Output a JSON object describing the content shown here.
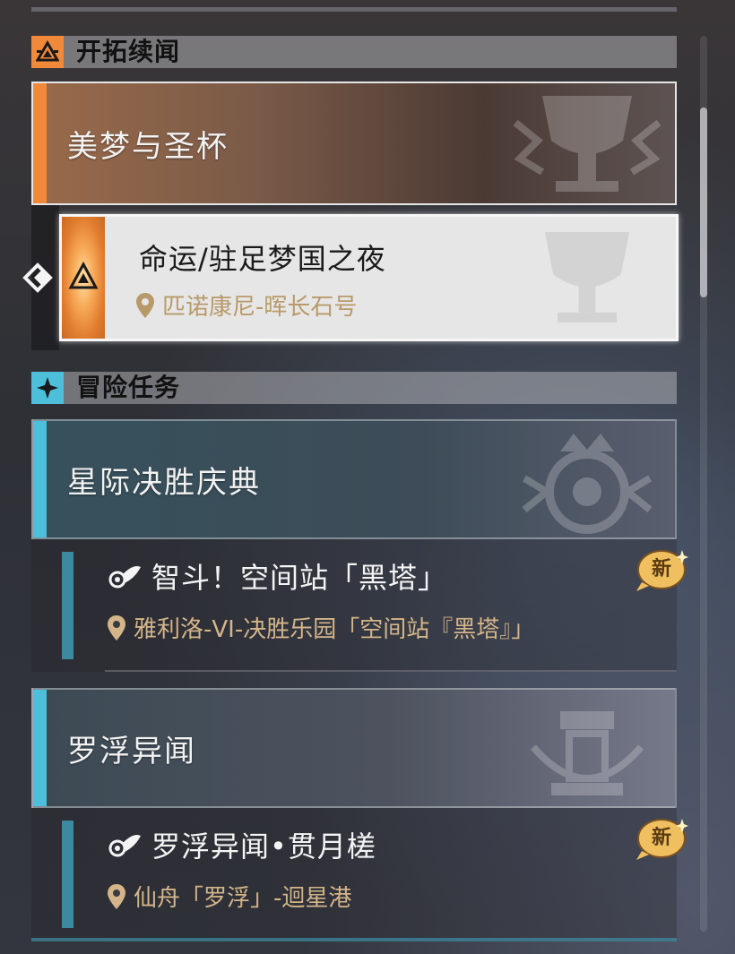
{
  "sections": [
    {
      "title": "开拓续闻",
      "icon": "trailblaze-triangle-icon",
      "accent": "#f08a3a"
    },
    {
      "title": "冒险任务",
      "icon": "adventure-star-icon",
      "accent": "#4dbfdb"
    }
  ],
  "groups": [
    {
      "title": "美梦与圣杯",
      "accent": "#f08a3a",
      "emblem": "grail-emblem-icon"
    },
    {
      "title": "星际决胜庆典",
      "accent": "#4dbfdb",
      "emblem": "crown-emblem-icon"
    },
    {
      "title": "罗浮异闻",
      "accent": "#4dbfdb",
      "emblem": "xianzhou-emblem-icon"
    }
  ],
  "quests": [
    {
      "title": "命运/驻足梦国之夜",
      "location": "匹诺康尼-晖长石号",
      "selected": true,
      "icon": "trailblaze-triangle-icon"
    },
    {
      "title": "智斗！空间站「黑塔」",
      "location": "雅利洛-VI-决胜乐园「空间站『黑塔』」",
      "badge": "新",
      "icon": "adventure-mission-icon"
    },
    {
      "title": "罗浮异闻•贯月槎",
      "location": "仙舟「罗浮」-迴星港",
      "badge": "新",
      "icon": "adventure-mission-icon"
    }
  ],
  "colors": {
    "trailblaze_accent": "#f08a3a",
    "adventure_accent": "#4dbfdb",
    "location_text": "#d4b58a"
  }
}
